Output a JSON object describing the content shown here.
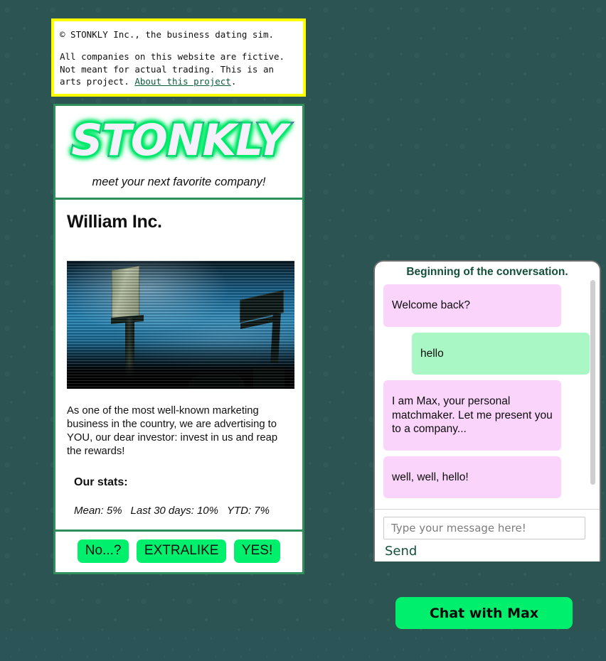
{
  "disclaimer": {
    "line1": "© STONKLY Inc., the business dating sim.",
    "line2_part1": "All companies on this website are fictive. Not meant for actual trading. This is an arts project. ",
    "link_text": "About this project",
    "line2_part2": "."
  },
  "brand": {
    "logo": "STONKLY",
    "tagline": "meet your next favorite company!",
    "accent_green": "#00f06e",
    "logo_purple": "#7b3fbf",
    "border_green": "#2f8f5b",
    "disclaimer_yellow": "#ffff00",
    "background_teal": "#2b5452"
  },
  "company": {
    "name": "William Inc.",
    "photo_alt": "billboards-against-blue-sky",
    "description": "As one of the most well-known marketing business in the country, we are advertising to YOU, our dear investor: invest in us and reap the rewards!",
    "stats_title": "Our stats:",
    "stats": [
      "Mean: 5%",
      "Last 30 days: 10%",
      "YTD: 7%"
    ]
  },
  "actions": {
    "no": "No...?",
    "extralike": "EXTRALIKE",
    "yes": "YES!"
  },
  "chat": {
    "beginning_label": "Beginning of the conversation.",
    "messages": [
      {
        "from": "them",
        "text": "Welcome back?"
      },
      {
        "from": "me",
        "text": "hello"
      },
      {
        "from": "them",
        "text": "I am Max, your personal matchmaker. Let me present you to a company..."
      },
      {
        "from": "them",
        "text": "well, well, hello!"
      }
    ],
    "input_placeholder": "Type your message here!",
    "input_value": "",
    "send_label": "Send",
    "bubble_them_color": "#fad4fb",
    "bubble_me_color": "#a9f7c4"
  },
  "chat_toggle": {
    "label": "Chat with Max"
  }
}
